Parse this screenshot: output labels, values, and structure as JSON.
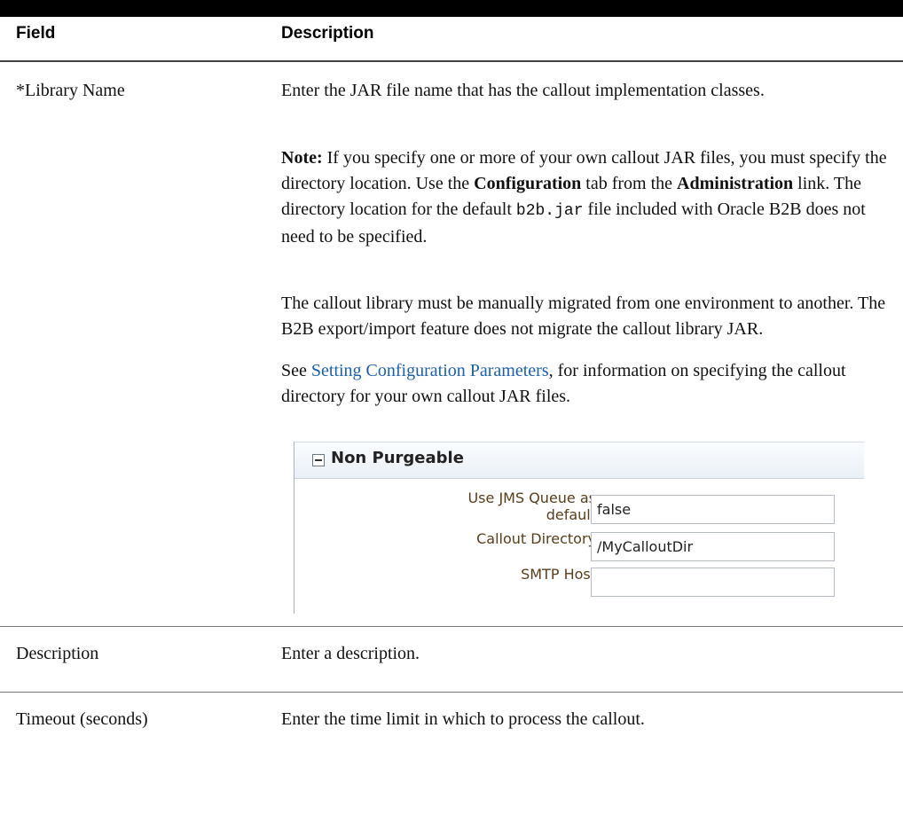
{
  "table": {
    "headers": {
      "field": "Field",
      "description": "Description"
    },
    "rows": [
      {
        "field": "*Library Name",
        "description": {
          "p1": "Enter the JAR file name that has the callout implementation classes.",
          "note_label": "Note:",
          "note_t1": " If you specify one or more of your own callout JAR files, you must specify the directory location. Use the ",
          "note_b1": "Configuration",
          "note_t2": " tab from the ",
          "note_b2": "Administration",
          "note_t3": " link. The directory location for the default ",
          "note_code": "b2b.jar",
          "note_t4": " file included with Oracle B2B does not need to be specified.",
          "p3": "The callout library must be manually migrated from one environment to another. The B2B export/import feature does not migrate the callout library JAR.",
          "see_prefix": "See ",
          "see_link": "Setting Configuration Parameters",
          "see_suffix": ", for information on specifying the callout directory for your own callout JAR files."
        }
      },
      {
        "field": "Description",
        "description": "Enter a description."
      },
      {
        "field": "Timeout (seconds)",
        "description": "Enter the time limit in which to process the callout."
      }
    ]
  },
  "panel": {
    "title": "Non Purgeable",
    "fields": [
      {
        "label_line1": "Use JMS Queue as",
        "label_line2": "default",
        "value": "false"
      },
      {
        "label": "Callout Directory",
        "value": "/MyCalloutDir"
      },
      {
        "label": "SMTP Host",
        "value": ""
      }
    ]
  }
}
